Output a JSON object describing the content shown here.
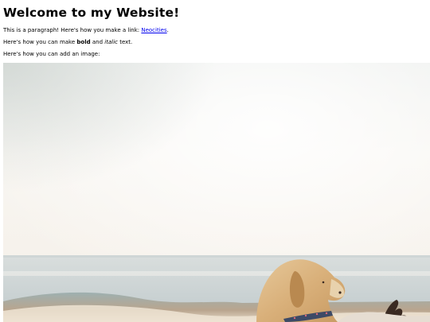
{
  "page": {
    "heading": "Welcome to my Website!",
    "paragraph1": {
      "before_link": "This is a paragraph! Here's how you make a link: ",
      "link_text": "Neocities",
      "after_link": "."
    },
    "paragraph2": {
      "before_bold": "Here's how you can make ",
      "bold_text": "bold",
      "between": " and ",
      "italic_text": "italic",
      "after_italic": " text."
    },
    "paragraph3": "Here's how you can add an image:",
    "image": {
      "subject": "dog-on-beach-photo"
    }
  },
  "colors": {
    "link": "#0000ee",
    "text": "#000000",
    "sky": "#f6f3ee",
    "sea": "#c9d3d6"
  }
}
